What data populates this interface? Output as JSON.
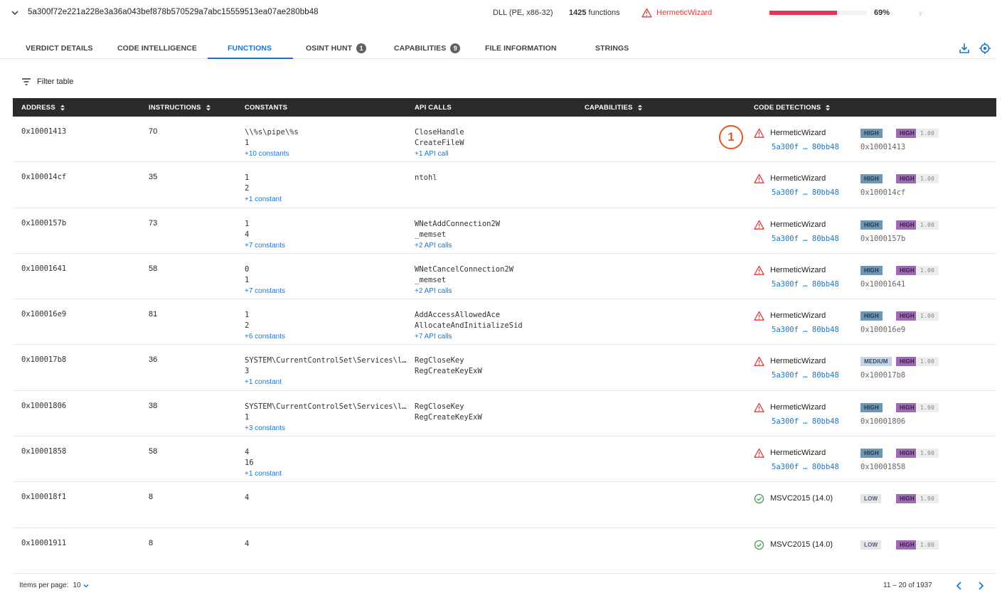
{
  "header": {
    "hash": "5a300f72e221a228e3a36a043bef878b570529a7abc15559513ea07ae280bb48",
    "file_type": "DLL (PE, x86-32)",
    "function_count": "1425",
    "function_label": "functions",
    "threat_name": "HermeticWizard",
    "similarity_percent": "69%",
    "similarity_value": 0.69,
    "faint_text": "y·"
  },
  "tabs": [
    {
      "label": "VERDICT DETAILS"
    },
    {
      "label": "CODE INTELLIGENCE"
    },
    {
      "label": "FUNCTIONS"
    },
    {
      "label": "OSINT HUNT",
      "badge": "1"
    },
    {
      "label": "CAPABILITIES",
      "badge": "9"
    },
    {
      "label": "FILE INFORMATION"
    },
    {
      "label": "STRINGS"
    }
  ],
  "active_tab": "FUNCTIONS",
  "filter_label": "Filter table",
  "columns": [
    "ADDRESS",
    "INSTRUCTIONS",
    "CONSTANTS",
    "API CALLS",
    "CAPABILITIES",
    "CODE DETECTIONS"
  ],
  "rows": [
    {
      "address": "0x10001413",
      "instructions": "70",
      "constants": [
        "\\\\%s\\pipe\\%s",
        "1"
      ],
      "constants_more": "+10 constants",
      "api_calls": [
        "CloseHandle",
        "CreateFileW"
      ],
      "api_more": "+1 API call",
      "detection": {
        "status": "threat",
        "name": "HermeticWizard",
        "hash": "5a300f … 80bb48",
        "address": "0x10001413",
        "severity": "HIGH",
        "confidence": "HIGH",
        "score": "1.00"
      }
    },
    {
      "address": "0x100014cf",
      "instructions": "35",
      "constants": [
        "1",
        "2"
      ],
      "constants_more": "+1 constant",
      "api_calls": [
        "ntohl"
      ],
      "api_more": "",
      "detection": {
        "status": "threat",
        "name": "HermeticWizard",
        "hash": "5a300f … 80bb48",
        "address": "0x100014cf",
        "severity": "HIGH",
        "confidence": "HIGH",
        "score": "1.00"
      }
    },
    {
      "address": "0x1000157b",
      "instructions": "73",
      "constants": [
        "1",
        "4"
      ],
      "constants_more": "+7 constants",
      "api_calls": [
        "WNetAddConnection2W",
        "_memset"
      ],
      "api_more": "+2 API calls",
      "detection": {
        "status": "threat",
        "name": "HermeticWizard",
        "hash": "5a300f … 80bb48",
        "address": "0x1000157b",
        "severity": "HIGH",
        "confidence": "HIGH",
        "score": "1.00"
      }
    },
    {
      "address": "0x10001641",
      "instructions": "58",
      "constants": [
        "0",
        "1"
      ],
      "constants_more": "+7 constants",
      "api_calls": [
        "WNetCancelConnection2W",
        "_memset"
      ],
      "api_more": "+2 API calls",
      "detection": {
        "status": "threat",
        "name": "HermeticWizard",
        "hash": "5a300f … 80bb48",
        "address": "0x10001641",
        "severity": "HIGH",
        "confidence": "HIGH",
        "score": "1.00"
      }
    },
    {
      "address": "0x100016e9",
      "instructions": "81",
      "constants": [
        "1",
        "2"
      ],
      "constants_more": "+6 constants",
      "api_calls": [
        "AddAccessAllowedAce",
        "AllocateAndInitializeSid"
      ],
      "api_more": "+7 API calls",
      "detection": {
        "status": "threat",
        "name": "HermeticWizard",
        "hash": "5a300f … 80bb48",
        "address": "0x100016e9",
        "severity": "HIGH",
        "confidence": "HIGH",
        "score": "1.00"
      }
    },
    {
      "address": "0x100017b8",
      "instructions": "36",
      "constants": [
        "SYSTEM\\CurrentControlSet\\Services\\l…",
        "3"
      ],
      "constants_more": "+1 constant",
      "api_calls": [
        "RegCloseKey",
        "RegCreateKeyExW"
      ],
      "api_more": "",
      "detection": {
        "status": "threat",
        "name": "HermeticWizard",
        "hash": "5a300f … 80bb48",
        "address": "0x100017b8",
        "severity": "MEDIUM",
        "confidence": "HIGH",
        "score": "1.00"
      }
    },
    {
      "address": "0x10001806",
      "instructions": "38",
      "constants": [
        "SYSTEM\\CurrentControlSet\\Services\\l…",
        "1"
      ],
      "constants_more": "+3 constants",
      "api_calls": [
        "RegCloseKey",
        "RegCreateKeyExW"
      ],
      "api_more": "",
      "detection": {
        "status": "threat",
        "name": "HermeticWizard",
        "hash": "5a300f … 80bb48",
        "address": "0x10001806",
        "severity": "HIGH",
        "confidence": "HIGH",
        "score": "1.00"
      }
    },
    {
      "address": "0x10001858",
      "instructions": "58",
      "constants": [
        "4",
        "16"
      ],
      "constants_more": "+1 constant",
      "api_calls": [],
      "api_more": "",
      "detection": {
        "status": "threat",
        "name": "HermeticWizard",
        "hash": "5a300f … 80bb48",
        "address": "0x10001858",
        "severity": "HIGH",
        "confidence": "HIGH",
        "score": "1.00"
      }
    },
    {
      "address": "0x100018f1",
      "instructions": "8",
      "constants": [
        "4"
      ],
      "constants_more": "",
      "api_calls": [],
      "api_more": "",
      "detection": {
        "status": "clean",
        "name": "MSVC2015 (14.0)",
        "hash": "",
        "address": "",
        "severity": "LOW",
        "confidence": "HIGH",
        "score": "1.00"
      }
    },
    {
      "address": "0x10001911",
      "instructions": "8",
      "constants": [
        "4"
      ],
      "constants_more": "",
      "api_calls": [],
      "api_more": "",
      "detection": {
        "status": "clean",
        "name": "MSVC2015 (14.0)",
        "hash": "",
        "address": "",
        "severity": "LOW",
        "confidence": "HIGH",
        "score": "1.00"
      }
    }
  ],
  "marker_label": "1",
  "footer": {
    "items_per_page_label": "Items per page:",
    "items_per_page_value": "10",
    "range": "11 – 20 of 1937"
  },
  "colors": {
    "accent": "#1976d2",
    "threat": "#e53935",
    "ok": "#43a047",
    "progress": "#e0365c",
    "header_bg": "#2b2b2b",
    "marker": "#e8541c"
  },
  "icons": {
    "expand": "chevron-down-icon",
    "threat": "warning-triangle-icon",
    "clean": "check-circle-icon",
    "filter": "filter-lines-icon",
    "download": "download-icon",
    "locate": "target-icon",
    "sort": "sort-icon",
    "prev": "chevron-left-icon",
    "next": "chevron-right-icon"
  }
}
